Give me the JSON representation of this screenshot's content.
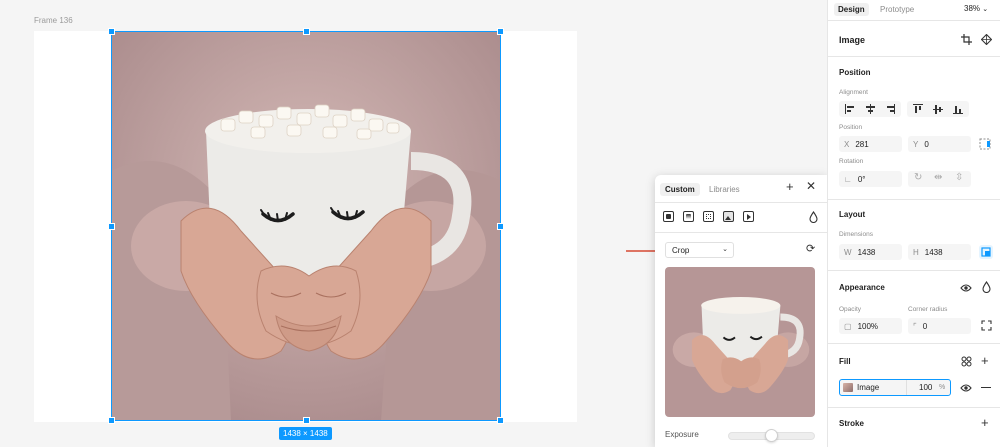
{
  "canvas": {
    "frame_label": "Frame 136",
    "selection_size": "1438 × 1438"
  },
  "popup": {
    "tabs": [
      {
        "label": "Custom",
        "active": true
      },
      {
        "label": "Libraries",
        "active": false
      }
    ],
    "add_icon": "plus-icon",
    "close_icon": "close-icon",
    "fill_types": [
      "solid-fill-icon",
      "gradient-fill-icon",
      "pattern-fill-icon",
      "image-fill-icon",
      "video-fill-icon"
    ],
    "blend_icon": "drop-icon",
    "crop_select": {
      "value": "Crop"
    },
    "rotate_icon": "rotate-icon",
    "exposure": {
      "label": "Exposure",
      "value": 0.5
    }
  },
  "panel": {
    "tabs": [
      {
        "label": "Design",
        "active": true
      },
      {
        "label": "Prototype",
        "active": false
      }
    ],
    "zoom": "38%",
    "layer_type": "Image",
    "position": {
      "title": "Position",
      "alignment_label": "Alignment",
      "position_label": "Position",
      "x_prefix": "X",
      "x": "281",
      "y_prefix": "Y",
      "y": "0",
      "rotation_label": "Rotation",
      "rotation": "0°"
    },
    "layout": {
      "title": "Layout",
      "dimensions_label": "Dimensions",
      "w_prefix": "W",
      "w": "1438",
      "h_prefix": "H",
      "h": "1438"
    },
    "appearance": {
      "title": "Appearance",
      "opacity_label": "Opacity",
      "opacity": "100%",
      "radius_label": "Corner radius",
      "radius": "0"
    },
    "fill": {
      "title": "Fill",
      "name": "Image",
      "opacity": "100",
      "unit": "%"
    },
    "stroke": {
      "title": "Stroke"
    }
  },
  "colors": {
    "accent": "#0d99ff",
    "arrow": "#d64933"
  }
}
